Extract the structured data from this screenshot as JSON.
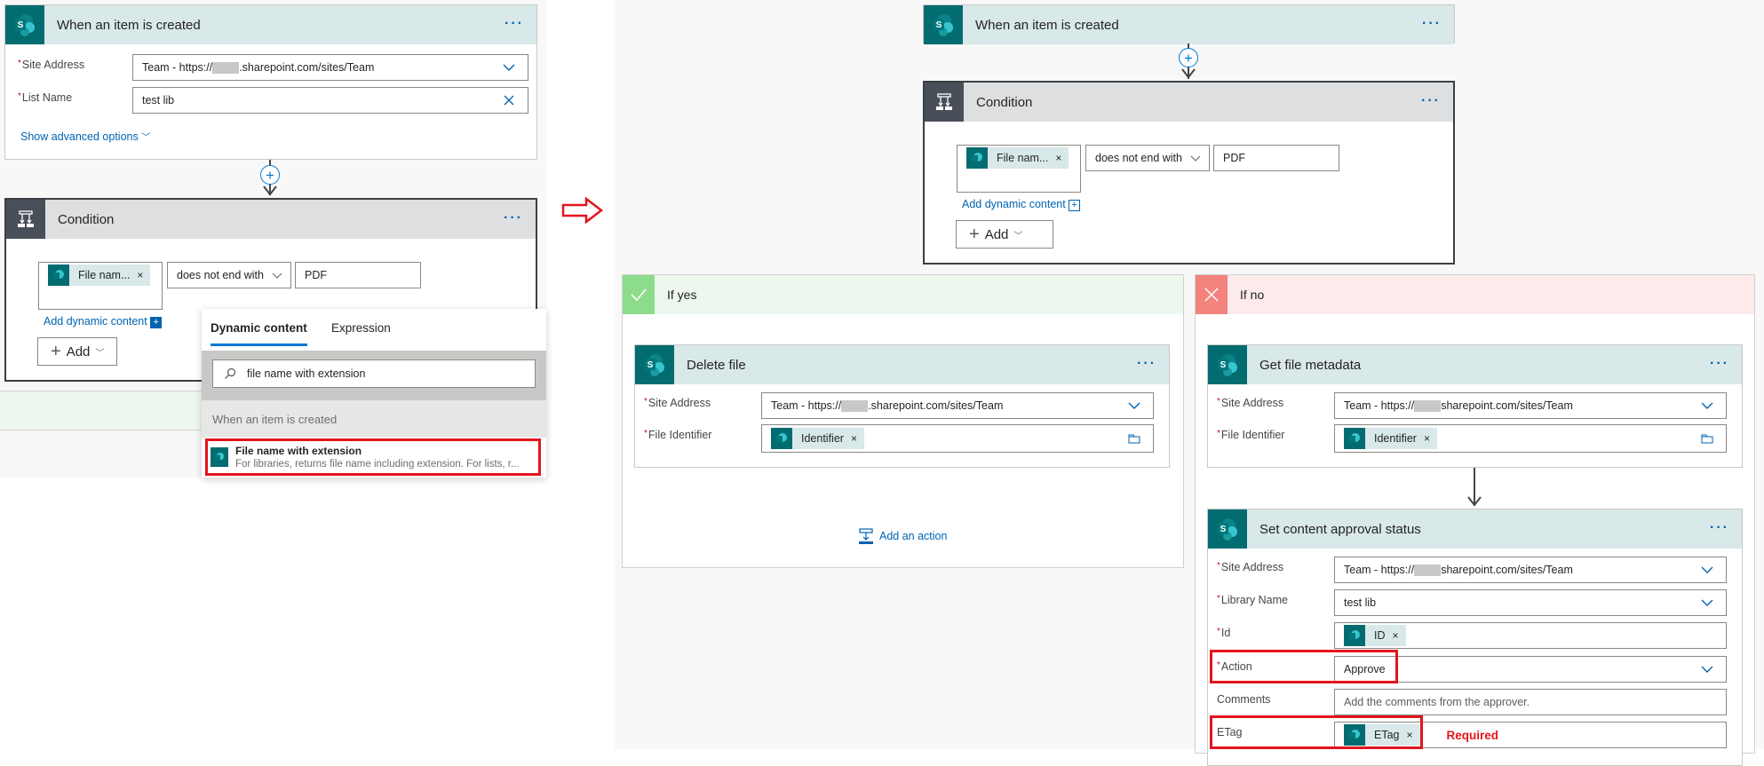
{
  "left": {
    "trigger": {
      "title": "When an item is created",
      "fields": [
        {
          "label": "Site Address",
          "required": true,
          "value_prefix": "Team - https://",
          "value_suffix": ".sharepoint.com/sites/Team"
        },
        {
          "label": "List Name",
          "required": true,
          "value": "test lib"
        }
      ],
      "advanced_link": "Show advanced options"
    },
    "condition": {
      "title": "Condition",
      "token_label": "File nam...",
      "operator": "does not end with",
      "value": "PDF",
      "add_dynamic": "Add dynamic content",
      "add_button": "Add"
    },
    "dynamic_panel": {
      "tabs": [
        "Dynamic content",
        "Expression"
      ],
      "search_value": "file name with extension",
      "group_label": "When an item is created",
      "item_title": "File name with extension",
      "item_desc": "For libraries, returns file name including extension. For lists, r..."
    }
  },
  "right": {
    "trigger": {
      "title": "When an item is created"
    },
    "condition": {
      "title": "Condition",
      "token_label": "File nam...",
      "operator": "does not end with",
      "value": "PDF",
      "add_dynamic": "Add dynamic content",
      "add_button": "Add"
    },
    "if_yes": {
      "title": "If yes",
      "action": {
        "title": "Delete file",
        "site_label": "Site Address",
        "site_prefix": "Team - https://",
        "site_suffix": ".sharepoint.com/sites/Team",
        "file_label": "File Identifier",
        "file_token": "Identifier"
      },
      "add_action": "Add an action"
    },
    "if_no": {
      "title": "If no",
      "get_meta": {
        "title": "Get file metadata",
        "site_label": "Site Address",
        "site_prefix": "Team - https://",
        "site_suffix": "sharepoint.com/sites/Team",
        "file_label": "File Identifier",
        "file_token": "Identifier"
      },
      "set_approval": {
        "title": "Set content approval status",
        "site_label": "Site Address",
        "site_prefix": "Team - https://",
        "site_suffix": "sharepoint.com/sites/Team",
        "library_label": "Library Name",
        "library_value": "test lib",
        "id_label": "Id",
        "id_token": "ID",
        "action_label": "Action",
        "action_value": "Approve",
        "comments_label": "Comments",
        "comments_placeholder": "Add the comments from the approver.",
        "etag_label": "ETag",
        "etag_token": "ETag",
        "required_note": "Required"
      }
    }
  },
  "colors": {
    "sharepoint": "#036c70",
    "accent": "#0063b1",
    "highlight": "#e3141e",
    "yes": "#8cdc8c",
    "no": "#f4837d"
  }
}
